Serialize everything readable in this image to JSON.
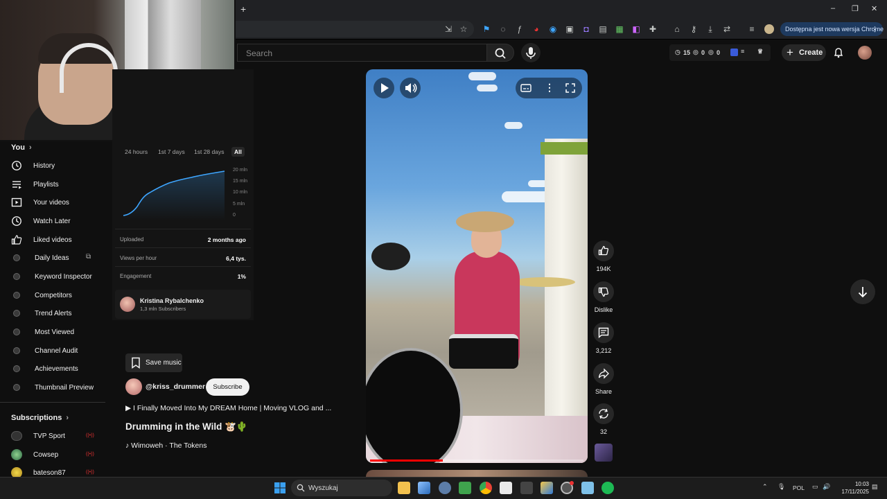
{
  "browser": {
    "new_tab_symbol": "+",
    "update_text": "Dostępna jest nowa wersja Chrome",
    "window_controls": [
      "–",
      "❐",
      "✕"
    ]
  },
  "header": {
    "search_placeholder": "Search",
    "stats": {
      "views": "15",
      "likes": "0",
      "comments": "0"
    },
    "create_label": "Create"
  },
  "sidebar": {
    "you_label": "You",
    "items": [
      {
        "label": "History",
        "icon": "history-icon"
      },
      {
        "label": "Playlists",
        "icon": "playlists-icon"
      },
      {
        "label": "Your videos",
        "icon": "your-videos-icon"
      },
      {
        "label": "Watch Later",
        "icon": "watch-later-icon"
      },
      {
        "label": "Liked videos",
        "icon": "liked-videos-icon"
      },
      {
        "label": "Daily Ideas",
        "icon": "extension-icon"
      },
      {
        "label": "Keyword Inspector",
        "icon": "extension-icon"
      },
      {
        "label": "Competitors",
        "icon": "extension-icon"
      },
      {
        "label": "Trend Alerts",
        "icon": "extension-icon"
      },
      {
        "label": "Most Viewed",
        "icon": "extension-icon"
      },
      {
        "label": "Channel Audit",
        "icon": "extension-icon"
      },
      {
        "label": "Achievements",
        "icon": "extension-icon"
      },
      {
        "label": "Thumbnail Preview",
        "icon": "extension-icon"
      }
    ],
    "subscriptions_label": "Subscriptions",
    "subscriptions": [
      {
        "name": "TVP Sport",
        "live": "((•))"
      },
      {
        "name": "Cowsep",
        "live": "((•))"
      },
      {
        "name": "bateson87",
        "live": "((•))"
      }
    ]
  },
  "stats_panel": {
    "tabs": [
      "24 hours",
      "1st 7 days",
      "1st 28 days",
      "All"
    ],
    "active_tab": "All",
    "y_ticks": [
      "20 mln",
      "15 mln",
      "10 mln",
      "5 mln",
      "0"
    ],
    "rows": [
      {
        "label": "Uploaded",
        "value": "2 months ago"
      },
      {
        "label": "Views per hour",
        "value": "6,4 tys."
      },
      {
        "label": "Engagement",
        "value": "1%"
      }
    ],
    "creator_name": "Kristina Rybalchenko",
    "creator_subs": "1,3 mln Subscribers"
  },
  "video": {
    "save_music_label": "Save music",
    "channel": "@kriss_drummer",
    "subscribe_label": "Subscribe",
    "related": "▶  I Finally Moved Into My DREAM Home | Moving VLOG and ...",
    "title": "Drumming in the Wild 🐮🌵",
    "music": "♪ Wimoweh · The Tokens",
    "progress": 0.34
  },
  "actions": {
    "likes": "194K",
    "dislike_label": "Dislike",
    "comments": "3,212",
    "share_label": "Share",
    "remix": "32"
  },
  "taskbar": {
    "search_placeholder": "Wyszukaj",
    "lang": "POL",
    "time": "10:03",
    "date": "17/11/2025"
  },
  "colors": {
    "accent": "#ff0000",
    "bg": "#0f0f0f",
    "update_pill": "#1e3a5f"
  }
}
